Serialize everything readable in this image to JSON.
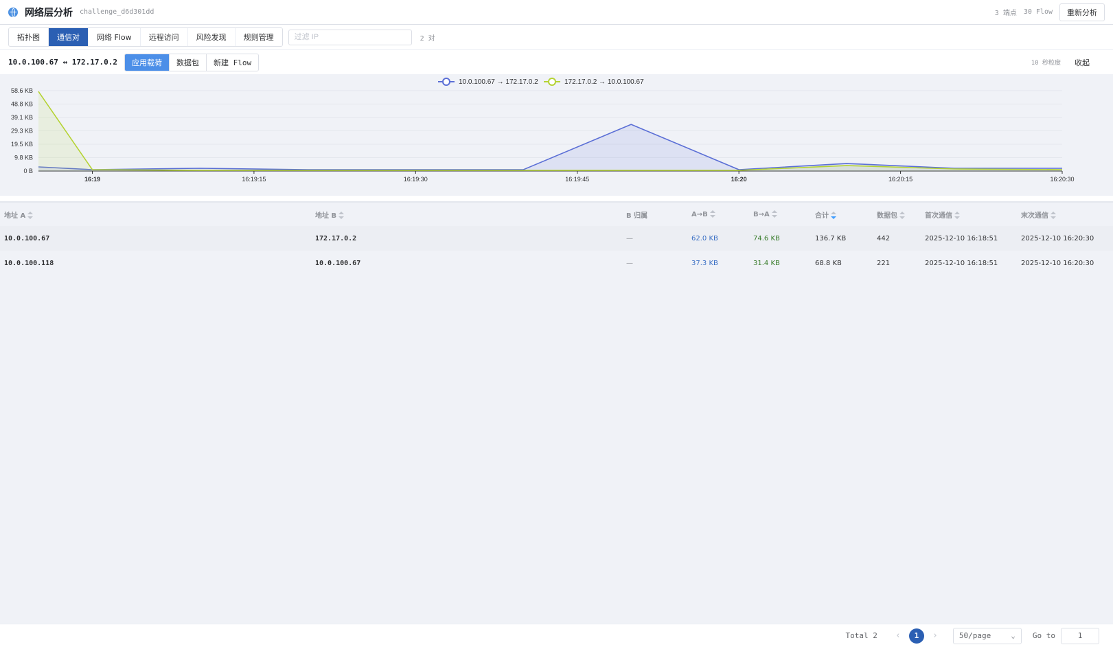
{
  "header": {
    "title": "网络层分析",
    "challenge": "challenge_d6d301dd",
    "endpoints": "3 端点",
    "flows": "30 Flow",
    "reanalyze": "重新分析"
  },
  "tabs": [
    {
      "label": "拓扑图"
    },
    {
      "label": "通信对"
    },
    {
      "label": "网络 Flow"
    },
    {
      "label": "远程访问"
    },
    {
      "label": "风险发现"
    },
    {
      "label": "规则管理"
    }
  ],
  "filter": {
    "placeholder": "过滤 IP",
    "count": "2 对"
  },
  "pair": {
    "label": "10.0.100.67 ↔ 172.17.0.2",
    "views": [
      {
        "label": "应用载荷"
      },
      {
        "label": "数据包"
      },
      {
        "label": "新建 Flow"
      }
    ],
    "granularity": "10 秒粒度",
    "collapse": "收起"
  },
  "chart_data": {
    "type": "area",
    "x": [
      "16:18:55",
      "16:19:00",
      "16:19:10",
      "16:19:20",
      "16:19:30",
      "16:19:40",
      "16:19:50",
      "16:20:00",
      "16:20:10",
      "16:20:20",
      "16:20:30"
    ],
    "x_ticks": [
      "16:19",
      "16:19:15",
      "16:19:30",
      "16:19:45",
      "16:20",
      "16:20:15",
      "16:20:30"
    ],
    "y_ticks": [
      "0 B",
      "9.8 KB",
      "19.5 KB",
      "29.3 KB",
      "39.1 KB",
      "48.8 KB",
      "58.6 KB"
    ],
    "ylim": [
      0,
      58.6
    ],
    "series": [
      {
        "name": "10.0.100.67 → 172.17.0.2",
        "color": "#5b6fd6",
        "values": [
          3.0,
          1.0,
          2.0,
          1.0,
          1.0,
          1.0,
          34.0,
          1.0,
          5.5,
          2.0,
          2.0
        ]
      },
      {
        "name": "172.17.0.2 → 10.0.100.67",
        "color": "#b5d334",
        "values": [
          58.0,
          1.0,
          0.5,
          0.5,
          0.5,
          0.5,
          0.5,
          0.5,
          4.0,
          1.5,
          1.0
        ]
      }
    ]
  },
  "table": {
    "columns": [
      "地址 A",
      "地址 B",
      "B 归属",
      "A→B",
      "B→A",
      "合计",
      "数据包",
      "首次通信",
      "末次通信"
    ],
    "rows": [
      {
        "a": "10.0.100.67",
        "b": "172.17.0.2",
        "owner": "—",
        "ab": "62.0 KB",
        "ba": "74.6 KB",
        "total": "136.7 KB",
        "packets": "442",
        "first": "2025-12-10 16:18:51",
        "last": "2025-12-10 16:20:30"
      },
      {
        "a": "10.0.100.118",
        "b": "10.0.100.67",
        "owner": "—",
        "ab": "37.3 KB",
        "ba": "31.4 KB",
        "total": "68.8 KB",
        "packets": "221",
        "first": "2025-12-10 16:18:51",
        "last": "2025-12-10 16:20:30"
      }
    ]
  },
  "pagination": {
    "total": "Total 2",
    "current": "1",
    "page_size": "50/page",
    "goto_label": "Go to",
    "goto_value": "1"
  }
}
